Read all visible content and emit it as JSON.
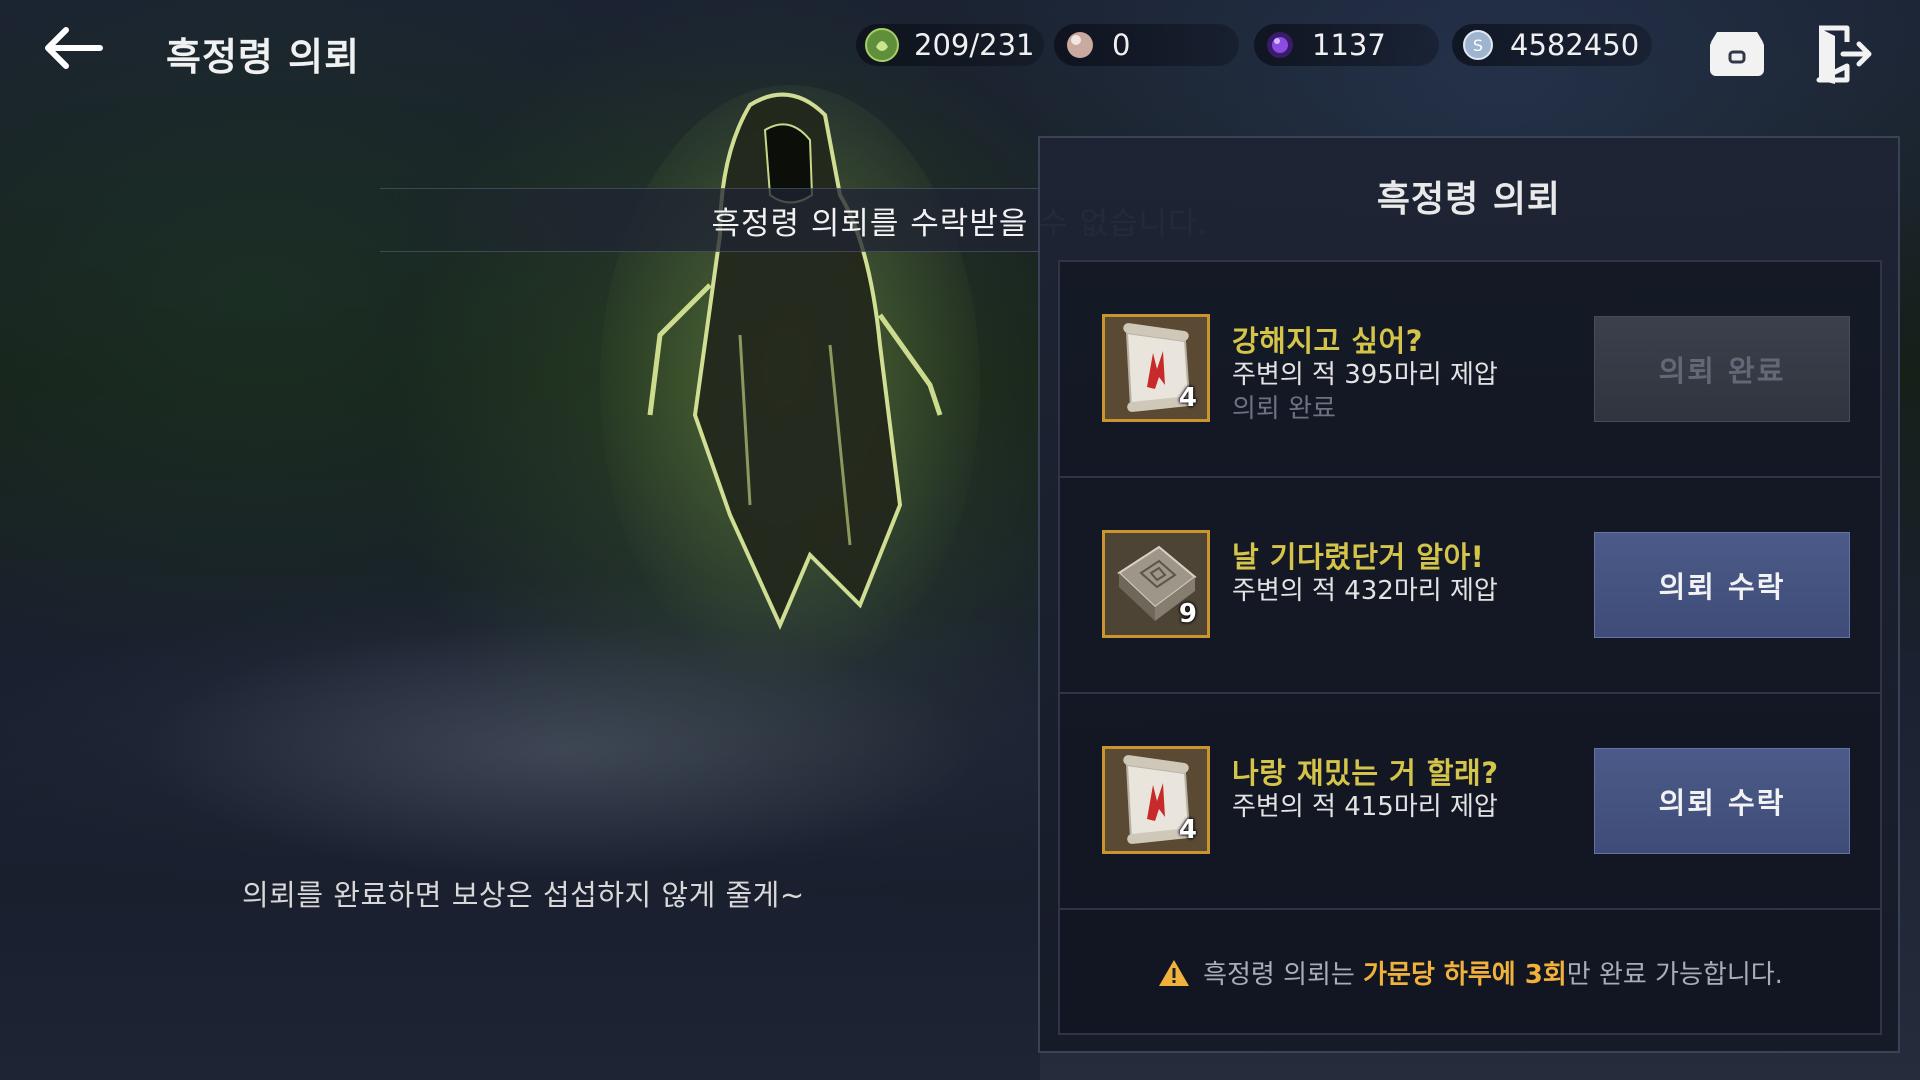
{
  "header": {
    "title": "흑정령 의뢰",
    "back_icon": "back-arrow-icon"
  },
  "currencies": {
    "stamina": {
      "icon": "energy-icon",
      "value": "209/231"
    },
    "pearl": {
      "icon": "pearl-icon",
      "value": "0"
    },
    "gem": {
      "icon": "black-gem-icon",
      "value": "1137"
    },
    "silver": {
      "icon": "silver-coin-icon",
      "value": "4582450"
    }
  },
  "toolbar": {
    "storage_icon": "storage-box-icon",
    "exit_icon": "exit-door-icon"
  },
  "notice": "흑정령 의뢰를 수락받을 수 없습니다.",
  "npc_dialog": "의뢰를 완료하면 보상은 섭섭하지 않게 줄게~",
  "panel": {
    "title": "흑정령 의뢰",
    "quests": [
      {
        "name": "강해지고 싶어?",
        "description": "주변의 적 395마리 제압",
        "status": "의뢰 완료",
        "reward_icon": "scroll-icon",
        "reward_count": "4",
        "button_label": "의뢰 완료",
        "button_enabled": false
      },
      {
        "name": "날 기다렸단거 알아!",
        "description": "주변의 적 432마리 제압",
        "status": "",
        "reward_icon": "stone-tablet-icon",
        "reward_count": "9",
        "button_label": "의뢰 수락",
        "button_enabled": true
      },
      {
        "name": "나랑 재밌는 거 할래?",
        "description": "주변의 적 415마리 제압",
        "status": "",
        "reward_icon": "scroll-icon",
        "reward_count": "4",
        "button_label": "의뢰 수락",
        "button_enabled": true
      }
    ],
    "footer": {
      "icon": "warning-icon",
      "prefix": "흑정령 의뢰는 ",
      "highlight": "가문당 하루에 3회",
      "suffix": "만 완료 가능합니다."
    }
  },
  "colors": {
    "quest_name": "#d4c54a",
    "highlight": "#f0b23a",
    "accept_button": "#4b5a88",
    "reward_border": "#c9952e"
  }
}
